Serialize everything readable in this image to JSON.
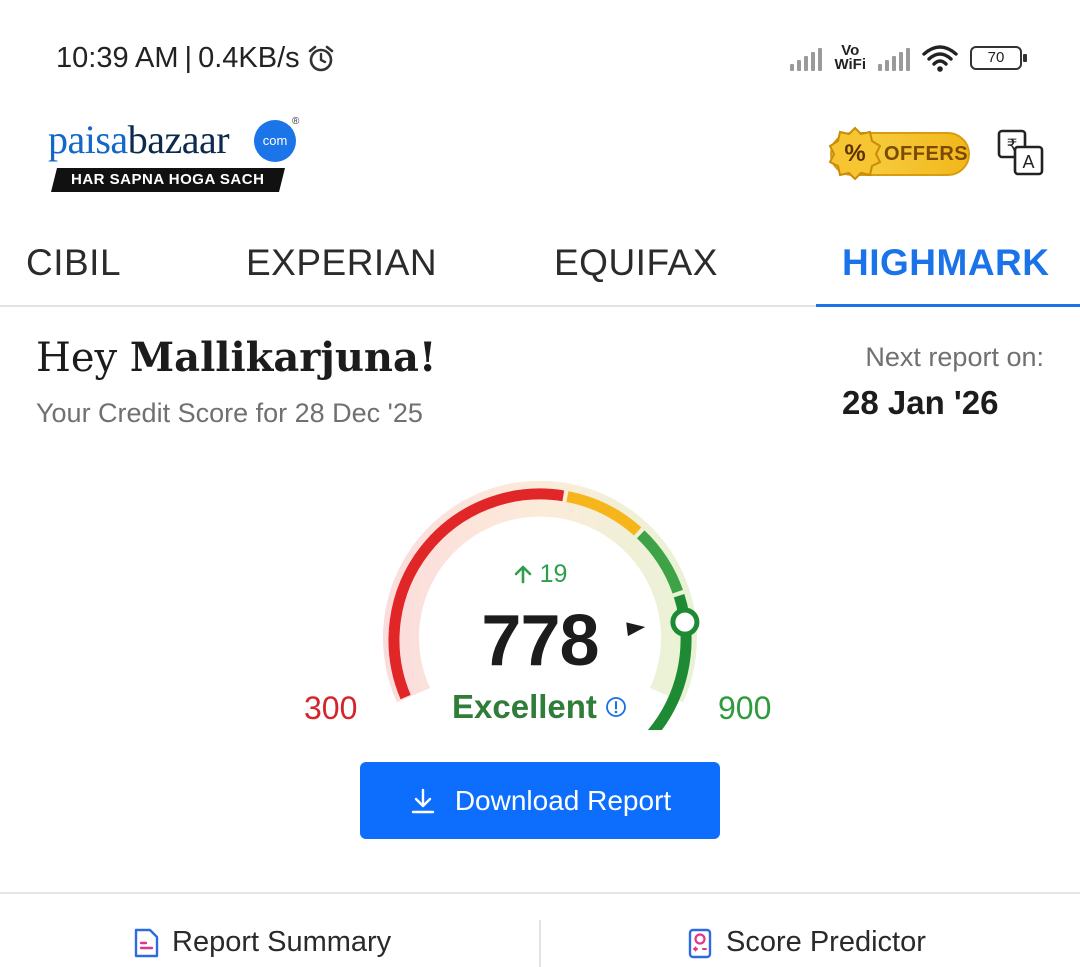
{
  "status_bar": {
    "time": "10:39 AM",
    "separator": "|",
    "speed": "0.4KB/s",
    "vowifi_top": "Vo",
    "vowifi_bottom": "WiFi",
    "battery": "70",
    "icons": [
      "alarm-icon",
      "signal-icon",
      "wifi-icon",
      "battery-icon"
    ]
  },
  "header": {
    "logo_paisa": "paisa",
    "logo_bazaar": "bazaar",
    "logo_com": "com",
    "logo_reg": "®",
    "logo_tagline": "HAR SAPNA HOGA SACH",
    "offers_label": "OFFERS",
    "offers_symbol": "%"
  },
  "tabs": [
    {
      "label": "CIBIL",
      "active": false
    },
    {
      "label": "EXPERIAN",
      "active": false
    },
    {
      "label": "EQUIFAX",
      "active": false
    },
    {
      "label": "HIGHMARK",
      "active": true
    }
  ],
  "greeting": {
    "hey": "Hey ",
    "name": "Mallikarjuna!",
    "subtitle": "Your Credit Score for 28 Dec '25",
    "next_label": "Next report on:",
    "next_date": "28 Jan '26"
  },
  "score": {
    "value": "778",
    "change": "19",
    "change_direction": "up",
    "rating": "Excellent",
    "min": "300",
    "max": "900",
    "colors": {
      "poor": "#e12628",
      "average": "#f5b51b",
      "good": "#3da346",
      "excellent": "#1f8a34"
    }
  },
  "download": {
    "label": "Download Report"
  },
  "bottom_nav": {
    "report_summary": "Report Summary",
    "score_predictor": "Score Predictor"
  },
  "accent": "#1a73e8"
}
